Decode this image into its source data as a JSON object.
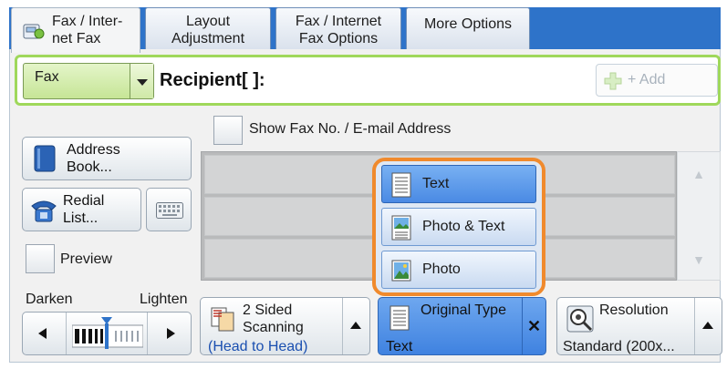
{
  "tabs": [
    {
      "label_l1": "Fax / Inter-",
      "label_l2": "net Fax",
      "active": true
    },
    {
      "label_l1": "Layout",
      "label_l2": "Adjustment",
      "active": false
    },
    {
      "label_l1": "Fax / Internet",
      "label_l2": "Fax Options",
      "active": false
    },
    {
      "label_l1": "More Options",
      "label_l2": "",
      "active": false
    }
  ],
  "address_bar": {
    "mode_value": "Fax",
    "recipient_label": "Recipient[    ]:",
    "add_button": "+ Add"
  },
  "show_fax_label": "Show Fax No. / E-mail Address",
  "left_buttons": {
    "address_book_l1": "Address",
    "address_book_l2": "Book...",
    "redial_l1": "Redial",
    "redial_l2": "List...",
    "preview_label": "Preview"
  },
  "density": {
    "darken_label": "Darken",
    "lighten_label": "Lighten"
  },
  "features": {
    "two_sided": {
      "title_l1": "2 Sided",
      "title_l2": "Scanning",
      "value": "(Head to Head)"
    },
    "original_type": {
      "title": "Original Type",
      "value": "Text"
    },
    "resolution": {
      "title": "Resolution",
      "value": "Standard (200x..."
    }
  },
  "original_type_menu": {
    "options": [
      "Text",
      "Photo & Text",
      "Photo"
    ],
    "selected": "Text"
  },
  "colors": {
    "tab_bar": "#2e73c9",
    "address_border": "#9fd85b",
    "popup_border": "#f08a2d",
    "selected_blue": "#4a8ae4"
  }
}
